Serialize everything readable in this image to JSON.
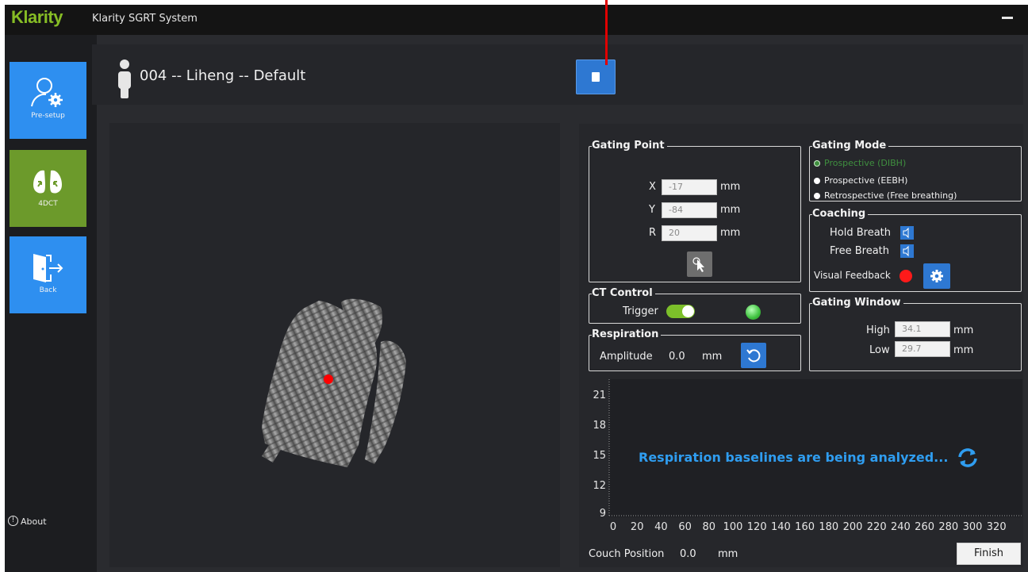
{
  "titlebar": {
    "brand": "Klarity",
    "title": "Klarity SGRT System"
  },
  "sidebar": {
    "items": [
      {
        "label": "Pre-setup",
        "icon": "user-gear-icon"
      },
      {
        "label": "4DCT",
        "icon": "lungs-icon"
      },
      {
        "label": "Back",
        "icon": "exit-door-icon"
      }
    ],
    "about": "About"
  },
  "header": {
    "patient": "004 -- Liheng -- Default"
  },
  "gating_point": {
    "title": "Gating Point",
    "x_label": "X",
    "x_value": "-17",
    "x_unit": "mm",
    "y_label": "Y",
    "y_value": "-84",
    "y_unit": "mm",
    "r_label": "R",
    "r_value": "20",
    "r_unit": "mm"
  },
  "gating_mode": {
    "title": "Gating Mode",
    "options": [
      "Prospective (DIBH)",
      "Prospective (EEBH)",
      "Retrospective (Free breathing)"
    ],
    "selected": 0
  },
  "coaching": {
    "title": "Coaching",
    "hold_breath": "Hold Breath",
    "free_breath": "Free Breath",
    "visual_feedback": "Visual Feedback"
  },
  "ct_control": {
    "title": "CT Control",
    "trigger": "Trigger",
    "trigger_on": true
  },
  "respiration": {
    "title": "Respiration",
    "amplitude_label": "Amplitude",
    "amplitude_value": "0.0",
    "unit": "mm"
  },
  "gating_window": {
    "title": "Gating Window",
    "high_label": "High",
    "high_value": "34.1",
    "low_label": "Low",
    "low_value": "29.7",
    "unit": "mm"
  },
  "chart": {
    "message": "Respiration baselines are being analyzed...",
    "y_ticks": [
      "21",
      "18",
      "15",
      "12",
      "9"
    ],
    "x_ticks": [
      "0",
      "20",
      "40",
      "60",
      "80",
      "100",
      "120",
      "140",
      "160",
      "180",
      "200",
      "220",
      "240",
      "260",
      "280",
      "300",
      "320"
    ]
  },
  "footer": {
    "couch_label": "Couch Position",
    "couch_value": "0.0",
    "couch_unit": "mm",
    "finish": "Finish"
  },
  "colors": {
    "accent_blue": "#2e78d2",
    "brand_green": "#86bc25",
    "sidebar_green": "#6c9a2b",
    "status_green": "#4cd04c",
    "alert_red": "#ff1a1a"
  }
}
